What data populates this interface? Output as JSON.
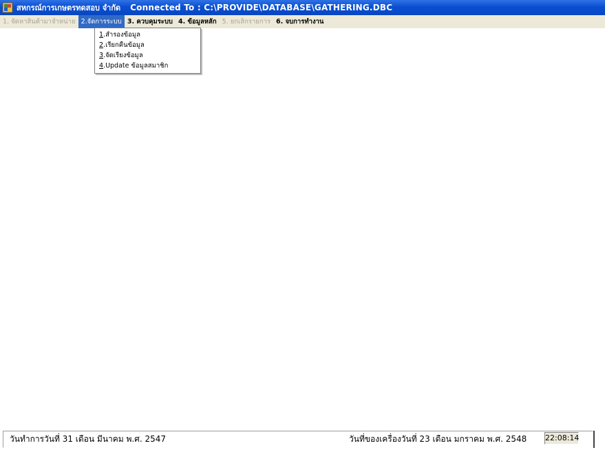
{
  "titlebar": {
    "app_name": "สหกรณ์การเกษตรทดสอบ จำกัด",
    "connection": "Connected To : C:\\PROVIDE\\DATABASE\\GATHERING.DBC"
  },
  "menu": [
    {
      "label": "1. จัดหาสินค้ามาจำหน่าย",
      "state": "disabled"
    },
    {
      "label": "2.จัดการระบบ",
      "state": "active"
    },
    {
      "label": "3. ควบคุมระบบ",
      "state": "enabled"
    },
    {
      "label": "4. ข้อมูลหลัก",
      "state": "enabled"
    },
    {
      "label": "5. ยกเลิกรายการ",
      "state": "disabled"
    },
    {
      "label": "6. จบการทำงาน",
      "state": "enabled"
    }
  ],
  "dropdown": [
    {
      "key": "1",
      "label": ".สำรองข้อมูล"
    },
    {
      "key": "2",
      "label": ".เรียกคืนข้อมูล"
    },
    {
      "key": "3",
      "label": ".จัดเรียงข้อมูล"
    },
    {
      "key": "4",
      "label": ".Update ข้อมูลสมาชิก"
    }
  ],
  "status": {
    "work_date": "วันทำการวันที่ 31 เดือน มีนาคม พ.ศ. 2547",
    "machine_date": "วันที่ของเครื่องวันที่ 23 เดือน มกราคม พ.ศ. 2548",
    "clock": "22:08:14"
  },
  "colors": {
    "titlebar": "#0a4fd1",
    "menu_active": "#316ac5",
    "menubar": "#ece9d8"
  },
  "icons": {
    "app": "app-icon"
  }
}
